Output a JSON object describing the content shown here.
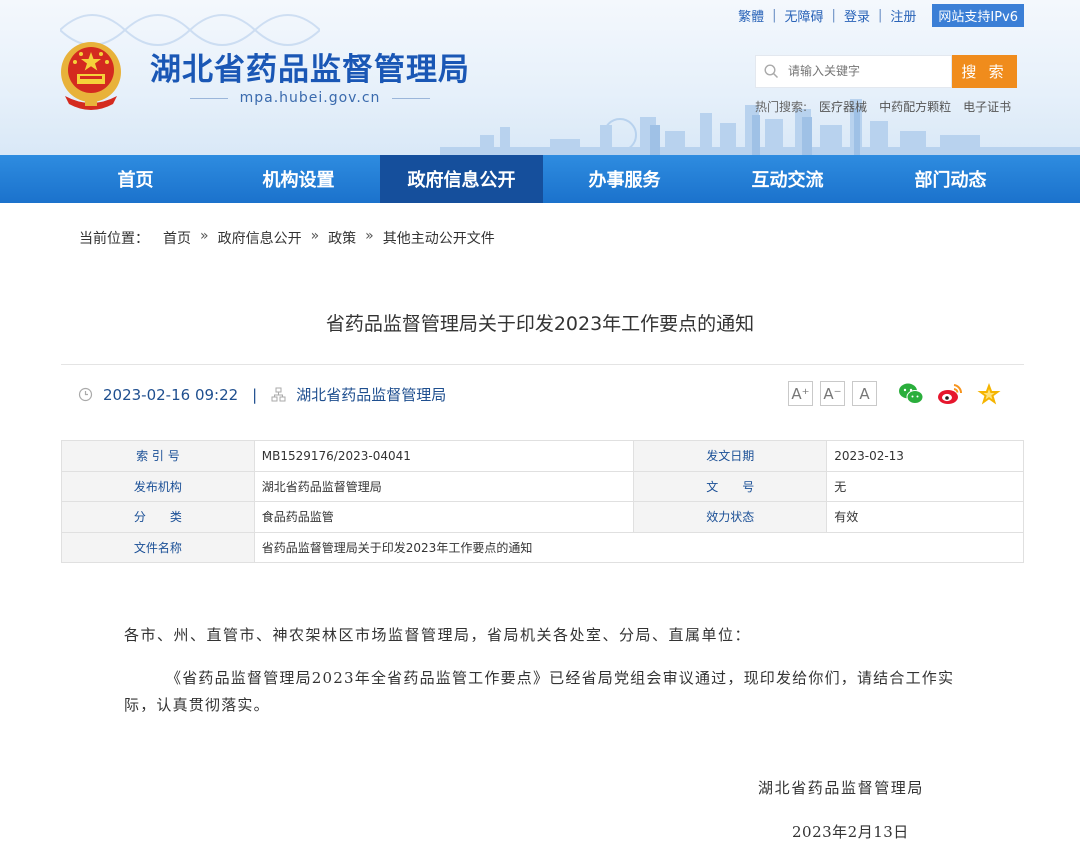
{
  "header": {
    "site_title": "湖北省药品监督管理局",
    "domain": "mpa.hubei.gov.cn",
    "toplinks": [
      "繁體",
      "无障碍",
      "登录",
      "注册"
    ],
    "ipv6": "网站支持IPv6",
    "search": {
      "placeholder": "请输入关键字",
      "button": "搜 索"
    },
    "hot_label": "热门搜索:",
    "hot_words": [
      "医疗器械",
      "中药配方颗粒",
      "电子证书"
    ]
  },
  "nav": {
    "items": [
      "首页",
      "机构设置",
      "政府信息公开",
      "办事服务",
      "互动交流",
      "部门动态"
    ],
    "active_index": 2
  },
  "breadcrumb": {
    "label": "当前位置：",
    "items": [
      "首页",
      "政府信息公开",
      "政策",
      "其他主动公开文件"
    ],
    "separator": "»"
  },
  "article": {
    "title": "省药品监督管理局关于印发2023年工作要点的通知",
    "datetime": "2023-02-16 09:22",
    "separator": "|",
    "publisher": "湖北省药品监督管理局",
    "font_buttons": [
      "A⁺",
      "A⁻",
      "A"
    ],
    "share_icons": [
      "wechat-icon",
      "weibo-icon",
      "favorite-star-icon"
    ]
  },
  "info_table": {
    "rows": [
      [
        {
          "label": "索 引 号",
          "value": "MB1529176/2023-04041"
        },
        {
          "label": "发文日期",
          "value": "2023-02-13"
        }
      ],
      [
        {
          "label": "发布机构",
          "value": "湖北省药品监督管理局"
        },
        {
          "label": "文　　号",
          "value": "无"
        }
      ],
      [
        {
          "label": "分　　类",
          "value": "食品药品监管"
        },
        {
          "label": "效力状态",
          "value": "有效"
        }
      ]
    ],
    "last_row": {
      "label": "文件名称",
      "value": "省药品监督管理局关于印发2023年工作要点的通知"
    }
  },
  "body": {
    "salutation": "各市、州、直管市、神农架林区市场监督管理局，省局机关各处室、分局、直属单位：",
    "paragraph": "《省药品监督管理局2023年全省药品监管工作要点》已经省局党组会审议通过，现印发给你们，请结合工作实际，认真贯彻落实。",
    "signature": "湖北省药品监督管理局",
    "date": "2023年2月13日"
  },
  "colors": {
    "nav_bg": "#1b72cc",
    "nav_active": "#154f9c",
    "title_blue": "#1a57b5",
    "search_btn": "#f08c1c"
  }
}
